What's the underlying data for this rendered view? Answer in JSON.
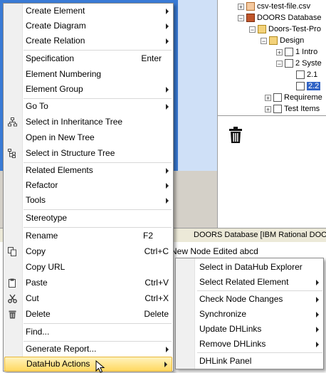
{
  "tree": {
    "items": [
      {
        "label": "csv-test-file.csv",
        "icon": "csv-file-icon"
      },
      {
        "label": "DOORS Database",
        "icon": "doors-database-icon"
      },
      {
        "label": "Doors-Test-Pro",
        "icon": "folder-icon"
      },
      {
        "label": "Design",
        "icon": "folder-icon"
      },
      {
        "label": "1 Intro",
        "icon": "section-icon"
      },
      {
        "label": "2 Syste",
        "icon": "section-icon"
      },
      {
        "label": "2.1",
        "icon": "section-icon"
      },
      {
        "label": "2.2",
        "icon": "section-icon"
      },
      {
        "label": "Requireme",
        "icon": "module-icon"
      },
      {
        "label": "Test Items",
        "icon": "module-icon"
      }
    ]
  },
  "status_bar": {
    "title": "DOORS Database [IBM Rational DOOR"
  },
  "edited_text": "New Node Edited abcd",
  "context_menu": {
    "items": [
      {
        "label": "Create Element",
        "submenu": true
      },
      {
        "label": "Create Diagram",
        "submenu": true
      },
      {
        "label": "Create Relation",
        "submenu": true
      },
      {
        "label": "Specification",
        "shortcut": "Enter"
      },
      {
        "label": "Element Numbering"
      },
      {
        "label": "Element Group",
        "submenu": true
      },
      {
        "label": "Go To",
        "submenu": true
      },
      {
        "label": "Select in Inheritance Tree",
        "icon": "inheritance-tree-icon"
      },
      {
        "label": "Open in New Tree"
      },
      {
        "label": "Select in Structure Tree",
        "icon": "structure-tree-icon"
      },
      {
        "label": "Related Elements",
        "submenu": true
      },
      {
        "label": "Refactor",
        "submenu": true
      },
      {
        "label": "Tools",
        "submenu": true
      },
      {
        "label": "Stereotype"
      },
      {
        "label": "Rename",
        "shortcut": "F2"
      },
      {
        "label": "Copy",
        "shortcut": "Ctrl+C",
        "icon": "copy-icon"
      },
      {
        "label": "Copy URL"
      },
      {
        "label": "Paste",
        "shortcut": "Ctrl+V",
        "icon": "paste-icon"
      },
      {
        "label": "Cut",
        "shortcut": "Ctrl+X",
        "icon": "cut-icon"
      },
      {
        "label": "Delete",
        "shortcut": "Delete",
        "icon": "delete-icon"
      },
      {
        "label": "Find..."
      },
      {
        "label": "Generate Report...",
        "submenu": true
      },
      {
        "label": "DataHub Actions",
        "submenu": true,
        "highlighted": true
      }
    ]
  },
  "datahub_submenu": {
    "items": [
      {
        "label": "Select in DataHub Explorer"
      },
      {
        "label": "Select Related Element",
        "submenu": true
      },
      {
        "label": "Check Node Changes",
        "submenu": true
      },
      {
        "label": "Synchronize",
        "submenu": true
      },
      {
        "label": "Update DHLinks",
        "submenu": true
      },
      {
        "label": "Remove DHLinks",
        "submenu": true
      },
      {
        "label": "DHLink Panel"
      }
    ]
  },
  "colors": {
    "highlight": "#ffd860",
    "selection": "#3163c5",
    "background_blue": "#3a7bd5"
  }
}
